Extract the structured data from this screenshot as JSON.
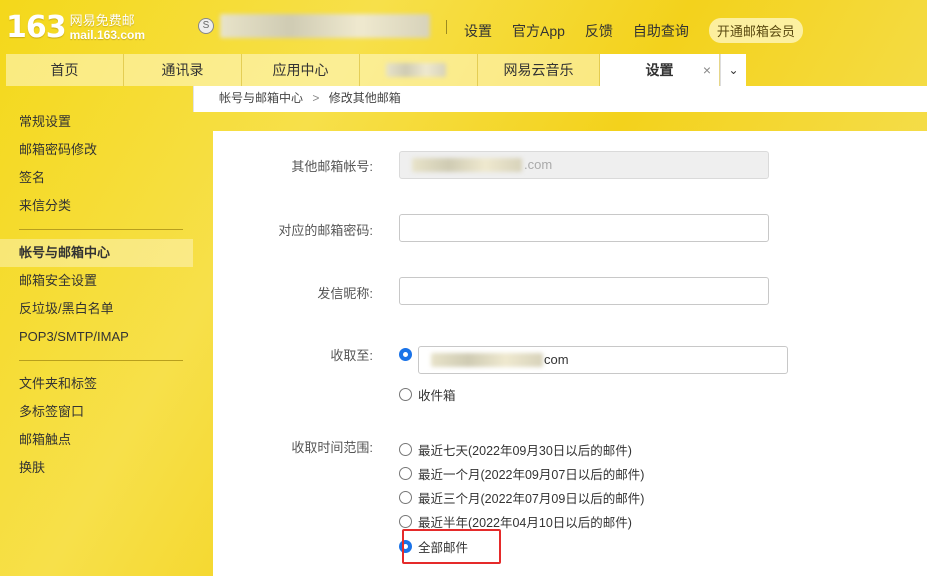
{
  "header": {
    "logo_number": "163",
    "logo_cn": "网易免费邮",
    "logo_en": "mail.163.com",
    "coin_glyph": "S",
    "top_links": [
      "设置",
      "官方App",
      "反馈",
      "自助查询"
    ],
    "vip_button": "开通邮箱会员"
  },
  "tabs": [
    {
      "label": "首页",
      "active": false
    },
    {
      "label": "通讯录",
      "active": false
    },
    {
      "label": "应用中心",
      "active": false
    },
    {
      "label": "",
      "active": false
    },
    {
      "label": "网易云音乐",
      "active": false
    },
    {
      "label": "设置",
      "active": true
    }
  ],
  "tab_close": "×",
  "tab_more": "⌄",
  "sidebar": {
    "group1": [
      "常规设置",
      "邮箱密码修改",
      "签名",
      "来信分类"
    ],
    "group2": [
      "帐号与邮箱中心",
      "邮箱安全设置",
      "反垃圾/黑白名单",
      "POP3/SMTP/IMAP"
    ],
    "group3": [
      "文件夹和标签",
      "多标签窗口",
      "邮箱触点",
      "换肤"
    ],
    "active": "帐号与邮箱中心"
  },
  "breadcrumb": {
    "parent": "帐号与邮箱中心",
    "separator": ">",
    "current": "修改其他邮箱"
  },
  "form": {
    "account_label": "其他邮箱帐号:",
    "account_suffix": ".com",
    "password_label": "对应的邮箱密码:",
    "password_value": "",
    "nickname_label": "发信昵称:",
    "nickname_value": "",
    "receive_to_label": "收取至:",
    "receive_to_suffix": "com",
    "inbox_option": "收件箱",
    "range_label": "收取时间范围:",
    "range_options": [
      "最近七天(2022年09月30日以后的邮件)",
      "最近一个月(2022年09月07日以后的邮件)",
      "最近三个月(2022年07月09日以后的邮件)",
      "最近半年(2022年04月10日以后的邮件)",
      "全部邮件"
    ],
    "selected_range": "全部邮件"
  },
  "colors": {
    "accent": "#1a73e8",
    "highlight_box": "#e52a2a",
    "theme": "#f4d81a"
  }
}
